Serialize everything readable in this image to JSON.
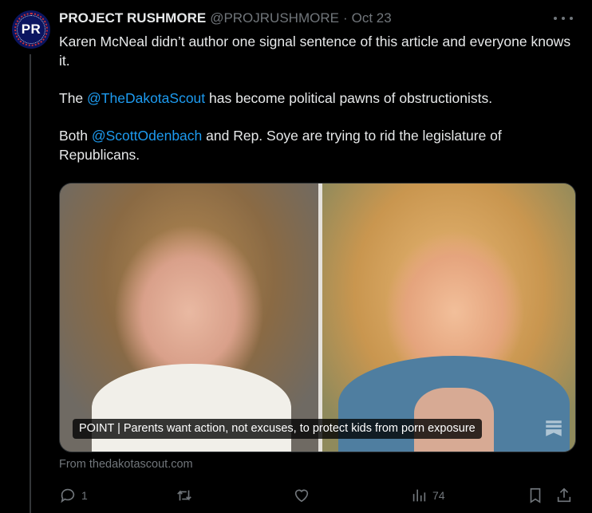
{
  "tweet": {
    "display_name": "PROJECT RUSHMORE",
    "handle": "@PROJRUSHMORE",
    "separator": "·",
    "date": "Oct 23",
    "avatar_text": "PR",
    "paragraphs": [
      {
        "before": "Karen McNeal didn’t author one signal sentence of this article and everyone knows it.",
        "mention": "",
        "after": ""
      },
      {
        "before": "The ",
        "mention": "@TheDakotaScout",
        "after": " has become political pawns of obstructionists."
      },
      {
        "before": "Both ",
        "mention": "@ScottOdenbach",
        "after": " and Rep. Soye are trying to rid the legislature of Republicans."
      }
    ]
  },
  "card": {
    "caption": "POINT | Parents want action, not excuses, to protect kids from porn exposure",
    "source": "From thedakotascout.com"
  },
  "actions": {
    "reply_count": "1",
    "retweet_count": "",
    "like_count": "",
    "views_count": "74"
  },
  "icons": {
    "more": "more-icon",
    "reply": "reply-icon",
    "retweet": "retweet-icon",
    "like": "heart-icon",
    "views": "views-icon",
    "bookmark": "bookmark-icon",
    "share": "share-icon"
  },
  "colors": {
    "background": "#000000",
    "text": "#e7e9ea",
    "secondary": "#71767b",
    "mention": "#1d9bf0",
    "avatar_bg": "#0b1560"
  }
}
